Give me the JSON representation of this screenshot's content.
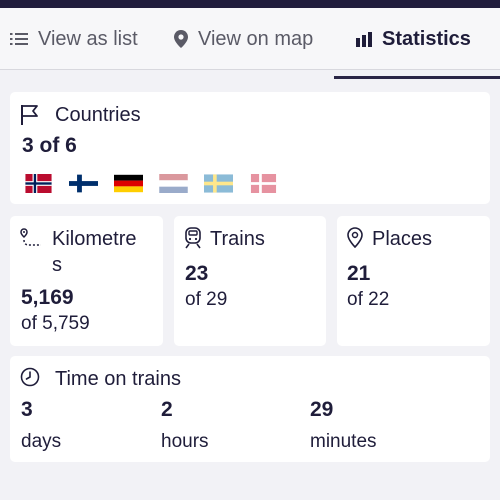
{
  "tabs": {
    "list_label": "View as list",
    "map_label": "View on map",
    "stats_label": "Statistics"
  },
  "countries": {
    "title": "Countries",
    "value": "3 of 6",
    "flags": [
      {
        "country": "Norway",
        "visited": true
      },
      {
        "country": "Finland",
        "visited": true
      },
      {
        "country": "Germany",
        "visited": true
      },
      {
        "country": "Netherlands",
        "visited": false
      },
      {
        "country": "Sweden",
        "visited": false
      },
      {
        "country": "Denmark",
        "visited": false
      }
    ]
  },
  "kilometres": {
    "title_line1": "Kilometre",
    "title_line2": "s",
    "value": "5,169",
    "of": "of 5,759"
  },
  "trains": {
    "title": "Trains",
    "value": "23",
    "of": "of 29"
  },
  "places": {
    "title": "Places",
    "value": "21",
    "of": "of 22"
  },
  "time": {
    "title": "Time on trains",
    "days_value": "3",
    "days_label": "days",
    "hours_value": "2",
    "hours_label": "hours",
    "minutes_value": "29",
    "minutes_label": "minutes"
  },
  "colors": {
    "dark": "#1f1d3a",
    "background": "#f2f2f6",
    "card": "#ffffff"
  }
}
